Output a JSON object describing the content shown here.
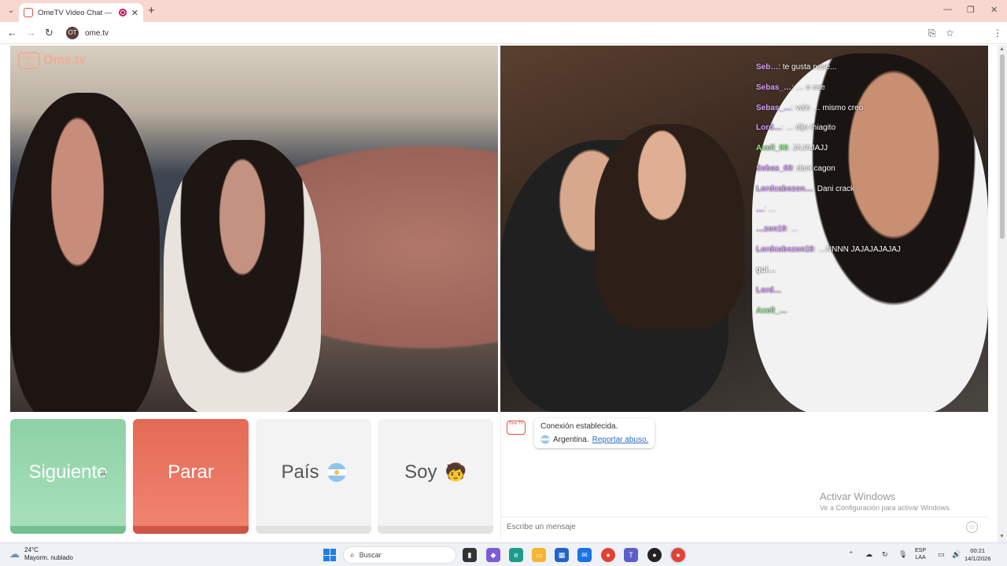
{
  "browser": {
    "tab_title": "OmeTV Video Chat — Ome",
    "new_tab_symbol": "+",
    "url": "ome.tv",
    "site_icon_glyph": "OT"
  },
  "page": {
    "logo_text": "Ome.tv",
    "overlay_chat": [
      {
        "name": "Seb…",
        "text": "te gusta nose...",
        "color": "#d9a2ff"
      },
      {
        "name": "Sebas_…",
        "text": "… o ese",
        "color": "#d9a2ff"
      },
      {
        "name": "Sebas_…",
        "text": "vale … mismo creo",
        "color": "#d9a2ff"
      },
      {
        "name": "Lord…",
        "text": "… dijo thiagito",
        "color": "#d9a2ff"
      },
      {
        "name": "Axell_96",
        "text": "JAJAJAJJ",
        "color": "#8ff08f"
      },
      {
        "name": "Sebas_09",
        "text": "dani cagon",
        "color": "#d9a2ff"
      },
      {
        "name": "Lordcabezon…",
        "text": "Dani crack",
        "color": "#d9a2ff"
      },
      {
        "name": "…",
        "text": "…",
        "color": "#d9a2ff"
      },
      {
        "name": "…zon19",
        "text": "…",
        "color": "#d9a2ff"
      },
      {
        "name": "Lordcabezon19",
        "text": "…NNNN JAJAJAJAJAJ",
        "color": "#d9a2ff"
      },
      {
        "name": "gui…",
        "text": "",
        "color": "#ffffff"
      },
      {
        "name": "Lord…",
        "text": "",
        "color": "#d9a2ff"
      },
      {
        "name": "Axell_…",
        "text": "",
        "color": "#8ff08f"
      }
    ]
  },
  "buttons": {
    "next": "Siguiente",
    "stop": "Parar",
    "country": "País",
    "gender": "Soy",
    "gender_emoji": "🧒"
  },
  "chat": {
    "avatar_glyph": "Ome TV",
    "status": "Conexión establecida.",
    "country": "Argentina.",
    "report_link": "Reportar abuso.",
    "input_placeholder": "Escribe un mensaje",
    "watermark_title": "Activar Windows",
    "watermark_subtitle": "Ve a Configuración para activar Windows."
  },
  "taskbar": {
    "temperature": "24°C",
    "weather": "Mayorm. nublado",
    "search_label": "Buscar",
    "lang_line1": "ESP",
    "lang_line2": "LAA",
    "time": "00:21",
    "date": "14/1/2026"
  },
  "colors": {
    "next_green": "#8ed1a5",
    "stop_red": "#e46a56",
    "neutral_button": "#f3f3f3",
    "chrome_tabstrip": "#f8d7d0",
    "link_blue": "#2d6cc5"
  }
}
